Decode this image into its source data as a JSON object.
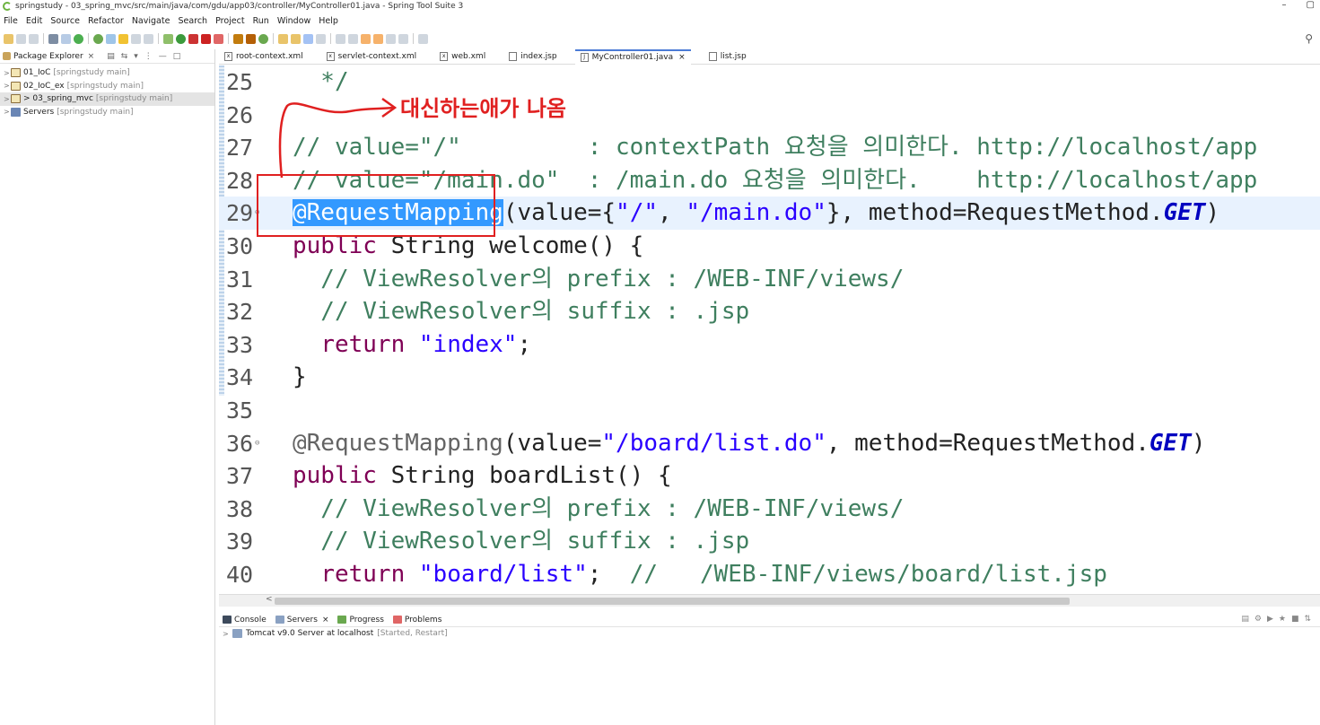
{
  "window": {
    "title": "springstudy - 03_spring_mvc/src/main/java/com/gdu/app03/controller/MyController01.java - Spring Tool Suite 3",
    "minimize": "–",
    "maximize": "▢"
  },
  "menu": [
    "File",
    "Edit",
    "Source",
    "Refactor",
    "Navigate",
    "Search",
    "Project",
    "Run",
    "Window",
    "Help"
  ],
  "package_explorer": {
    "tab_label": "Package Explorer",
    "close": "×",
    "items": [
      {
        "arrow": ">",
        "name": "01_IoC",
        "working_set": "[springstudy main]"
      },
      {
        "arrow": ">",
        "name": "02_IoC_ex",
        "working_set": "[springstudy main]"
      },
      {
        "arrow": ">",
        "name": "> 03_spring_mvc",
        "working_set": "[springstudy main]"
      },
      {
        "arrow": ">",
        "name": "Servers",
        "working_set": "[springstudy main]"
      }
    ]
  },
  "editor_tabs": [
    {
      "label": "root-context.xml",
      "icon": "x"
    },
    {
      "label": "servlet-context.xml",
      "icon": "x"
    },
    {
      "label": "web.xml",
      "icon": "x"
    },
    {
      "label": "index.jsp",
      "icon": ""
    },
    {
      "label": "MyController01.java",
      "icon": "J",
      "close": "×"
    },
    {
      "label": "list.jsp",
      "icon": ""
    }
  ],
  "code": {
    "lines": [
      {
        "n": "25",
        "parts": [
          {
            "c": "cm",
            "t": "  */"
          }
        ]
      },
      {
        "n": "26",
        "parts": []
      },
      {
        "n": "27",
        "parts": [
          {
            "c": "cm",
            "t": "// value=\"/\"         : contextPath 요청을 의미한다. http://localhost/app"
          }
        ]
      },
      {
        "n": "28",
        "parts": [
          {
            "c": "cm",
            "t": "// value=\"/main.do\"  : /main.do 요청을 의미한다.    http://localhost/app"
          }
        ]
      },
      {
        "n": "29",
        "parts": [
          {
            "c": "sel",
            "t": "@RequestMapping"
          },
          {
            "c": "",
            "t": "(value={"
          },
          {
            "c": "st",
            "t": "\"/\""
          },
          {
            "c": "",
            "t": ", "
          },
          {
            "c": "st",
            "t": "\"/main.do\""
          },
          {
            "c": "",
            "t": "}, method=RequestMethod."
          },
          {
            "c": "it",
            "t": "GET"
          },
          {
            "c": "",
            "t": ")"
          }
        ]
      },
      {
        "n": "30",
        "parts": [
          {
            "c": "kw",
            "t": "public"
          },
          {
            "c": "",
            "t": " String welcome() {"
          }
        ]
      },
      {
        "n": "31",
        "parts": [
          {
            "c": "cm",
            "t": "  // ViewResolver의 prefix : /WEB-INF/views/"
          }
        ]
      },
      {
        "n": "32",
        "parts": [
          {
            "c": "cm",
            "t": "  // ViewResolver의 suffix : .jsp"
          }
        ]
      },
      {
        "n": "33",
        "parts": [
          {
            "c": "",
            "t": "  "
          },
          {
            "c": "kw",
            "t": "return"
          },
          {
            "c": "",
            "t": " "
          },
          {
            "c": "st",
            "t": "\"index\""
          },
          {
            "c": "",
            "t": ";"
          }
        ]
      },
      {
        "n": "34",
        "parts": [
          {
            "c": "",
            "t": "}"
          }
        ]
      },
      {
        "n": "35",
        "parts": []
      },
      {
        "n": "36",
        "parts": [
          {
            "c": "an",
            "t": "@RequestMapping"
          },
          {
            "c": "",
            "t": "(value="
          },
          {
            "c": "st",
            "t": "\"/board/list.do\""
          },
          {
            "c": "",
            "t": ", method=RequestMethod."
          },
          {
            "c": "it",
            "t": "GET"
          },
          {
            "c": "",
            "t": ")"
          }
        ]
      },
      {
        "n": "37",
        "parts": [
          {
            "c": "kw",
            "t": "public"
          },
          {
            "c": "",
            "t": " String boardList() {"
          }
        ]
      },
      {
        "n": "38",
        "parts": [
          {
            "c": "cm",
            "t": "  // ViewResolver의 prefix : /WEB-INF/views/"
          }
        ]
      },
      {
        "n": "39",
        "parts": [
          {
            "c": "cm",
            "t": "  // ViewResolver의 suffix : .jsp"
          }
        ]
      },
      {
        "n": "40",
        "parts": [
          {
            "c": "",
            "t": "  "
          },
          {
            "c": "kw",
            "t": "return"
          },
          {
            "c": "",
            "t": " "
          },
          {
            "c": "st",
            "t": "\"board/list\""
          },
          {
            "c": "",
            "t": ";  "
          },
          {
            "c": "cm",
            "t": "//   /WEB-INF/views/board/list.jsp"
          }
        ]
      }
    ]
  },
  "annotation": {
    "text": "대신하는애가 나옴",
    "color": "#e02020"
  },
  "scrollbar": {
    "left_arrow": "<"
  },
  "bottom_panel": {
    "tabs": [
      {
        "label": "Console",
        "close": ""
      },
      {
        "label": "Servers",
        "close": "×"
      },
      {
        "label": "Progress",
        "close": ""
      },
      {
        "label": "Problems",
        "close": ""
      }
    ],
    "server": {
      "arrow": ">",
      "name": "Tomcat v9.0 Server at localhost",
      "state": "[Started, Restart]"
    }
  },
  "colors": {
    "comment": "#3f7f5f",
    "keyword": "#7f0055",
    "string": "#2a00ff",
    "selection": "#3399ff",
    "current_line": "#e8f2fe"
  }
}
